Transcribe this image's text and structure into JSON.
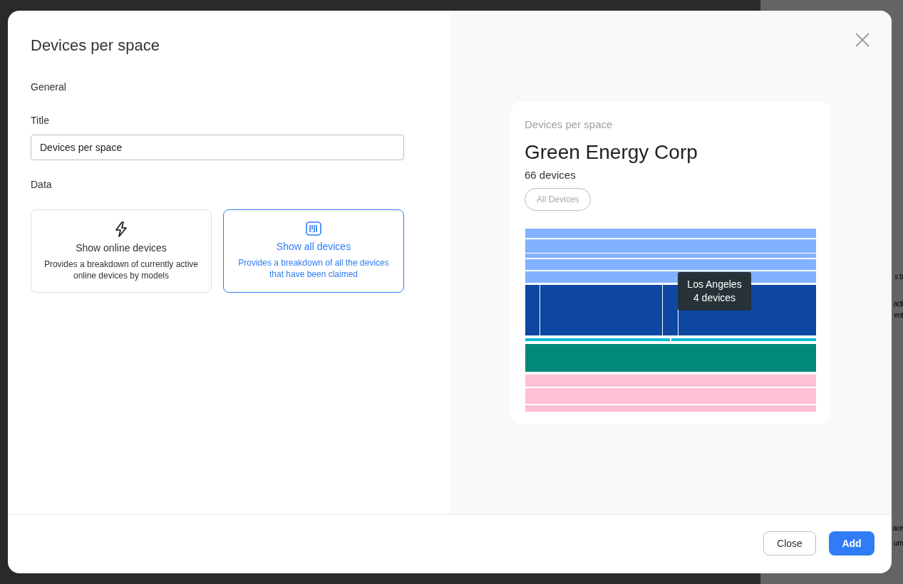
{
  "background": {
    "fragments": [
      "s b",
      "acti",
      "ent",
      "ace",
      "um"
    ]
  },
  "dialog": {
    "title": "Devices per space",
    "section_general": "General",
    "title_field": {
      "label": "Title",
      "value": "Devices per space"
    },
    "section_data": "Data",
    "options": [
      {
        "kind": "online",
        "label": "Show online devices",
        "description": "Provides a breakdown of currently active online devices by models",
        "selected": false
      },
      {
        "kind": "all",
        "label": "Show all devices",
        "description": "Provides a breakdown of all the devices that have been claimed",
        "selected": true
      }
    ],
    "preview": {
      "subtitle": "Devices per space",
      "heading": "Green Energy Corp",
      "count": "66 devices",
      "filter": "All Devices",
      "tooltip": {
        "title": "Los Angeles",
        "value": "4 devices"
      }
    },
    "buttons": [
      {
        "kind": "secondary",
        "label": "Close"
      },
      {
        "kind": "primary",
        "label": "Add"
      }
    ]
  }
}
